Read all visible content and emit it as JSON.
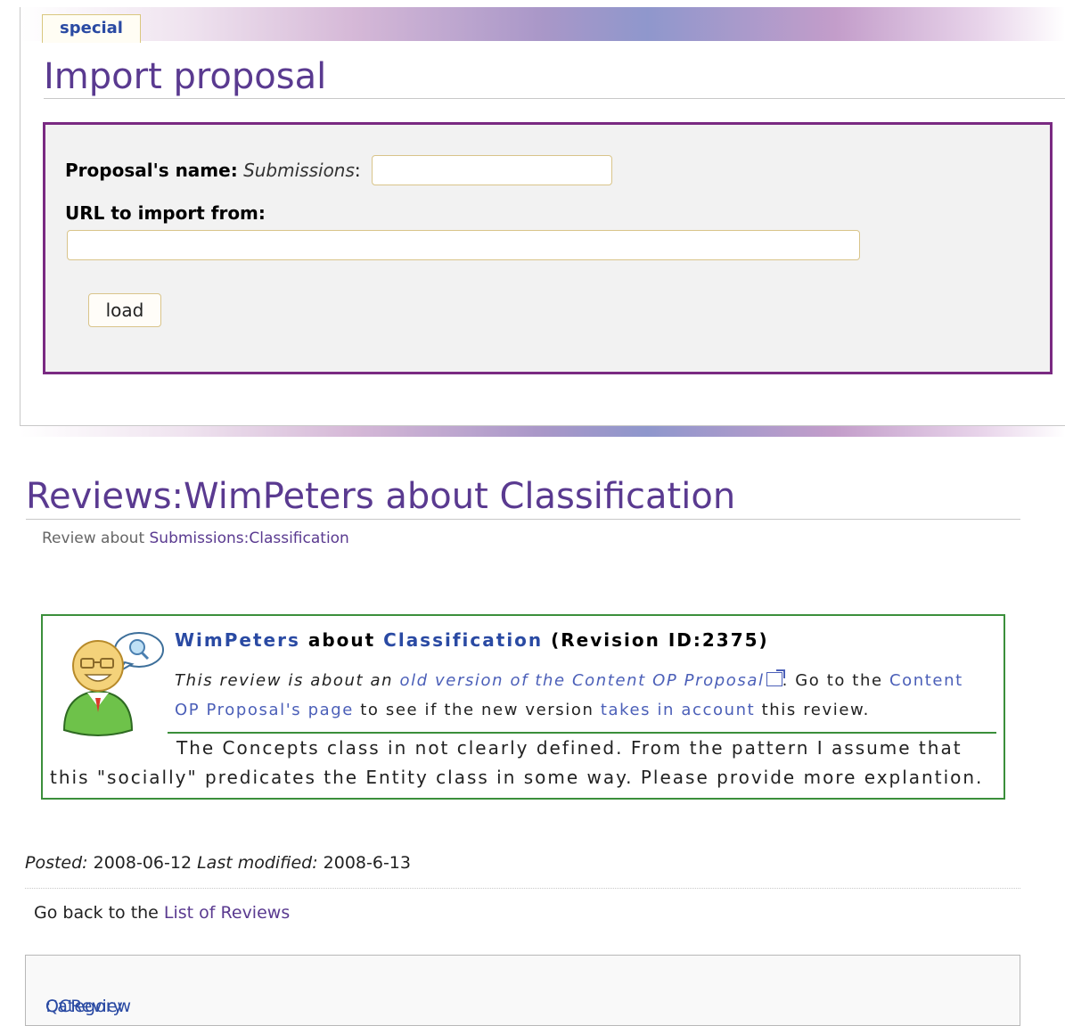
{
  "top": {
    "tab_label": "special",
    "title": "Import proposal",
    "form": {
      "name_label": "Proposal's name:",
      "name_prefix": "Submissions",
      "name_colon": ":",
      "name_value": "",
      "url_label": "URL to import from:",
      "url_value": "",
      "load_label": "load"
    }
  },
  "review": {
    "title": "Reviews:WimPeters about Classification",
    "sub_prefix": "Review about ",
    "sub_link": "Submissions:Classification",
    "header_author": "WimPeters",
    "header_about": " about ",
    "header_topic": "Classification",
    "header_rev": " (Revision ID:2375)",
    "note_pre": "This review is about an ",
    "note_link1": "old version of the Content OP Proposal",
    "note_mid": ". Go to the ",
    "note_link2": "Content OP Proposal's page",
    "note_mid2": " to see if the new version ",
    "note_link3": "takes in account",
    "note_post": " this review.",
    "body": "The Concepts class in not clearly defined. From the pattern I assume that this \"socially\" predicates the Entity class in some way. Please provide more explantion."
  },
  "meta": {
    "posted_label": "Posted:",
    "posted_value": " 2008-06-12 ",
    "modified_label": "Last modified:",
    "modified_value": " 2008-6-13",
    "goback_pre": "Go back to the ",
    "goback_link": "List of Reviews",
    "category_label": "Category",
    "category_sep": ": ",
    "category_value": "QCReview"
  }
}
